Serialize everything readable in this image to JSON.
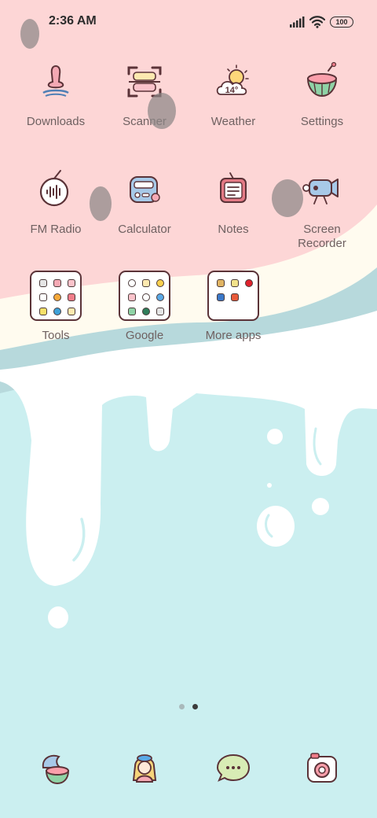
{
  "status_bar": {
    "time": "2:36 AM",
    "battery": "100"
  },
  "apps": [
    {
      "label": "Downloads",
      "icon": "downloads-icon"
    },
    {
      "label": "Scanner",
      "icon": "scanner-icon"
    },
    {
      "label": "Weather",
      "icon": "weather-icon",
      "temp": "14°"
    },
    {
      "label": "Settings",
      "icon": "settings-icon"
    },
    {
      "label": "FM Radio",
      "icon": "fm-radio-icon"
    },
    {
      "label": "Calculator",
      "icon": "calculator-icon"
    },
    {
      "label": "Notes",
      "icon": "notes-icon"
    },
    {
      "label": "Screen Recorder",
      "label_line1": "Screen",
      "label_line2": "Recorder",
      "icon": "screen-recorder-icon"
    }
  ],
  "folders": [
    {
      "label": "Tools"
    },
    {
      "label": "Google"
    },
    {
      "label": "More apps"
    }
  ],
  "page_indicator": {
    "pages": 2,
    "current": 2
  },
  "dock": [
    {
      "icon": "bird-cake-icon"
    },
    {
      "icon": "girl-character-icon"
    },
    {
      "icon": "chat-bubble-icon"
    },
    {
      "icon": "camera-icon"
    }
  ],
  "colors": {
    "pink": "#fdd6d6",
    "cream": "#fffbef",
    "blue_band": "#b7d9dc",
    "mint": "#cbeff0",
    "label": "#6f6161",
    "outline": "#5b3338"
  }
}
